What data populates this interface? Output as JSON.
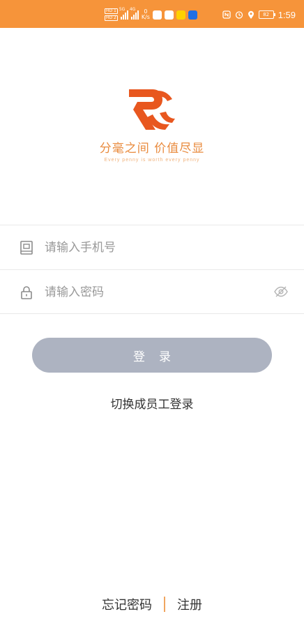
{
  "status_bar": {
    "hd1": "HD 1",
    "hd2": "HD 2",
    "net5g": "5G",
    "net4g": "4G",
    "speed_value": "0",
    "speed_unit": "K/s",
    "battery": "82",
    "time": "1:59"
  },
  "brand": {
    "slogan": "分毫之间 价值尽显",
    "slogan_en": "Every penny is worth every penny",
    "accent_color": "#f6943a",
    "logo_color": "#e8571f"
  },
  "form": {
    "phone_placeholder": "请输入手机号",
    "password_placeholder": "请输入密码",
    "login_label": "登录",
    "switch_label": "切换成员工登录"
  },
  "footer": {
    "forgot_label": "忘记密码",
    "register_label": "注册"
  }
}
